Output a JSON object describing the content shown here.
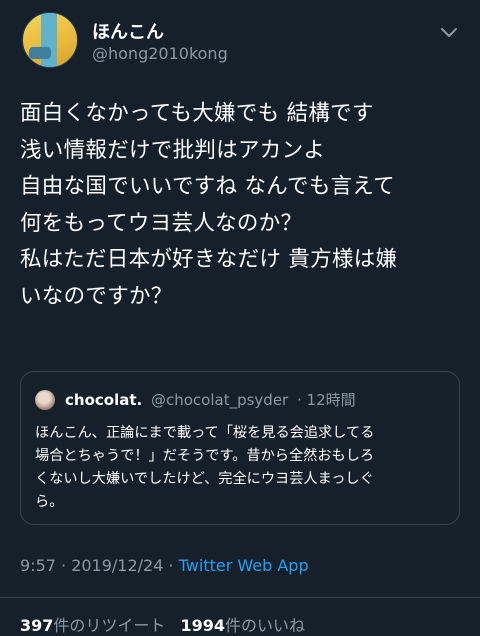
{
  "tweet": {
    "author_name": "ほんこん",
    "author_handle": "@hong2010kong",
    "lines": [
      "面白くなかっても大嫌でも 結構です",
      "浅い情報だけで批判はアカンよ",
      "自由な国でいいですね なんでも言えて",
      "何をもってウヨ芸人なのか？",
      "私はただ日本が好きなだけ 貴方様は嫌",
      "いなのですか？"
    ],
    "time": "9:57 · 2019/12/24 ·",
    "source": "Twitter Web App"
  },
  "quoted": {
    "name": "chocolat.",
    "handle": "@chocolat_psyder",
    "time": "· 12時間",
    "lines": [
      "ほんこん、正論にまで載って「桜を見る会追求してる",
      "場合とちゃうで！」だそうです。昔から全然おもしろ",
      "くないし大嫌いでしたけど、完全にウヨ芸人まっしぐ",
      "ら。"
    ]
  },
  "stats": {
    "retweets": "397",
    "retweets_label": "件のリツイート",
    "likes": "1994",
    "likes_label": "件のいいね"
  },
  "icons": {
    "menu": "chevron-down-icon"
  },
  "colors": {
    "background": "#15202b",
    "accent": "#1da1f2",
    "muted": "#8899a6",
    "border": "#38444d"
  }
}
